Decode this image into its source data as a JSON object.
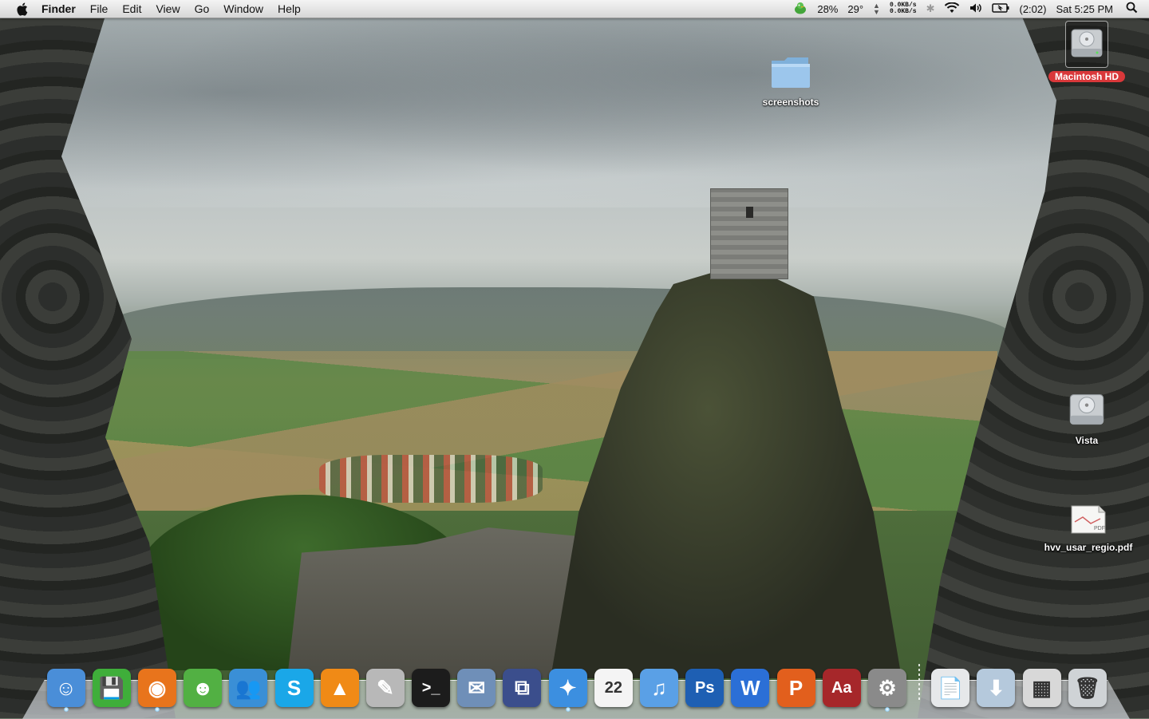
{
  "menubar": {
    "app_name": "Finder",
    "menus": [
      "File",
      "Edit",
      "View",
      "Go",
      "Window",
      "Help"
    ],
    "status": {
      "cpu_percent": "28%",
      "temperature": "29°",
      "net_up": "0.0KB/s",
      "net_down": "0.0KB/s",
      "battery_time": "(2:02)",
      "clock": "Sat 5:25 PM"
    }
  },
  "desktop": {
    "icons": [
      {
        "label": "screenshots",
        "kind": "folder-icon"
      },
      {
        "label": "Macintosh HD",
        "kind": "hard-drive-icon",
        "selected": true
      },
      {
        "label": "Vista",
        "kind": "hard-drive-icon"
      },
      {
        "label": "hvv_usar_regio.pdf",
        "kind": "pdf-document-icon"
      }
    ]
  },
  "dock": {
    "apps": [
      {
        "name": "Finder",
        "icon": "finder-icon",
        "color": "#4a8ed8",
        "glyph": "☺",
        "running": true
      },
      {
        "name": "Floppy",
        "icon": "floppy-disk-icon",
        "color": "#3fae3a",
        "glyph": "💾",
        "running": false
      },
      {
        "name": "Firefox",
        "icon": "firefox-icon",
        "color": "#e8741c",
        "glyph": "◉",
        "running": true
      },
      {
        "name": "Adium",
        "icon": "adium-duck-icon",
        "color": "#52b043",
        "glyph": "☻",
        "running": false
      },
      {
        "name": "Messenger",
        "icon": "messenger-buddies-icon",
        "color": "#3a8fd6",
        "glyph": "👥",
        "running": false
      },
      {
        "name": "Skype",
        "icon": "skype-icon",
        "color": "#1aa7e8",
        "glyph": "S",
        "running": false
      },
      {
        "name": "VLC",
        "icon": "vlc-cone-icon",
        "color": "#f08a16",
        "glyph": "▲",
        "running": false
      },
      {
        "name": "Script Editor",
        "icon": "script-editor-icon",
        "color": "#b8b8b8",
        "glyph": "✎",
        "running": false
      },
      {
        "name": "Terminal",
        "icon": "terminal-icon",
        "color": "#1c1c1c",
        "glyph": ">_",
        "running": false
      },
      {
        "name": "Mail",
        "icon": "mail-stamp-icon",
        "color": "#6f8fb8",
        "glyph": "✉",
        "running": false
      },
      {
        "name": "VMware Fusion",
        "icon": "vmware-fusion-icon",
        "color": "#3b4e8c",
        "glyph": "⧉",
        "running": false
      },
      {
        "name": "Safari",
        "icon": "safari-compass-icon",
        "color": "#3c8fe0",
        "glyph": "✦",
        "running": true
      },
      {
        "name": "iCal",
        "icon": "calendar-icon",
        "color": "#f4f4f4",
        "glyph": "22",
        "running": false
      },
      {
        "name": "iTunes",
        "icon": "itunes-icon",
        "color": "#5aa0e6",
        "glyph": "♫",
        "running": false
      },
      {
        "name": "Photoshop",
        "icon": "photoshop-icon",
        "color": "#1e5fb3",
        "glyph": "Ps",
        "running": false
      },
      {
        "name": "Word",
        "icon": "word-icon",
        "color": "#2b6fd6",
        "glyph": "W",
        "running": false
      },
      {
        "name": "PowerPoint",
        "icon": "powerpoint-icon",
        "color": "#e25f1d",
        "glyph": "P",
        "running": false
      },
      {
        "name": "Dictionary",
        "icon": "dictionary-icon",
        "color": "#a6272a",
        "glyph": "Aa",
        "running": false
      },
      {
        "name": "System Preferences",
        "icon": "system-preferences-icon",
        "color": "#8a8a8a",
        "glyph": "⚙",
        "running": true
      }
    ],
    "stacks": [
      {
        "name": "Documents",
        "icon": "documents-stack-icon",
        "color": "#e6e8ea",
        "glyph": "📄"
      },
      {
        "name": "Downloads",
        "icon": "downloads-stack-icon",
        "color": "#b5c9dc",
        "glyph": "⬇"
      },
      {
        "name": "Screenshots",
        "icon": "screenshots-stack-icon",
        "color": "#d8d8d8",
        "glyph": "▦"
      },
      {
        "name": "Trash",
        "icon": "trash-icon",
        "color": "#cfd3d6",
        "glyph": "🗑"
      }
    ]
  }
}
